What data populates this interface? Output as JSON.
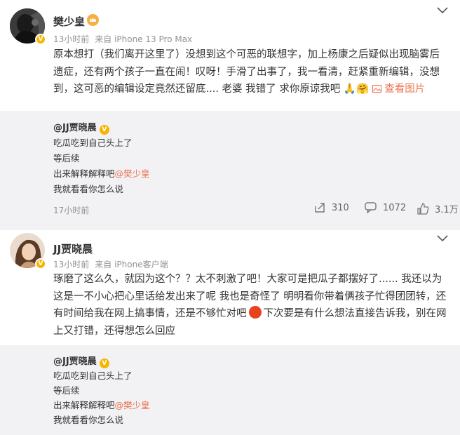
{
  "post1": {
    "username": "樊少皇",
    "time": "13小时前",
    "source": "来自 iPhone 13 Pro Max",
    "text_l1": "原本想打（我们离开这里了）没想到这个可恶的联想字，加上杨康之后疑似出现脑雾后",
    "text_l2": "遗症，还有两个孩子一直在闹！叹呀！手滑了出事了，我一看清，赶紧重新编辑，没想",
    "text_l3": "到，这可恶的编辑设定竟然还留底.... 老婆 我错了 求你原谅我吧",
    "emoji1": "🙏",
    "emoji2": "🤗",
    "view_image": "查看图片",
    "repost": {
      "user": "@JJ贾晓晨",
      "line1": "吃瓜吃到自己头上了",
      "line2": "等后续",
      "line3": "出来解释解释吧",
      "line3_at": "@樊少皇",
      "line4": "我就看看你怎么说",
      "time": "17小时前",
      "reposts": "310",
      "comments": "1072",
      "likes": "3.1万"
    }
  },
  "post2": {
    "username": "JJ贾晓晨",
    "time": "13小时前",
    "source": "来自 iPhone客户端",
    "text_l1": "琢磨了这么久，就因为这个？？太不刺激了吧！大家可是把瓜子都摆好了......  我还以为",
    "text_l2": "这是一不小心把心里话给发出来了呢 我也是奇怪了 明明看你带着俩孩子忙得团团转，还",
    "text_l3a": "有时间给我在网上搞事情，还是不够忙对吧",
    "text_l3b": "下次要是有什么想法直接告诉我，别在网",
    "text_l4": "上又打错，还得想怎么回应",
    "repost": {
      "user": "@JJ贾晓晨",
      "line1": "吃瓜吃到自己头上了",
      "line2": "等后续",
      "line3": "出来解释解释吧",
      "line3_at": "@樊少皇",
      "line4": "我就看看你怎么说"
    }
  },
  "colors": {
    "accent": "#eb7350",
    "badge": "#f7b500",
    "meta": "#939393",
    "repost_bg": "#f2f2f5"
  },
  "icons": [
    "chevron-down-icon",
    "verified-badge-icon",
    "repost-icon",
    "comment-icon",
    "like-icon",
    "image-icon"
  ]
}
